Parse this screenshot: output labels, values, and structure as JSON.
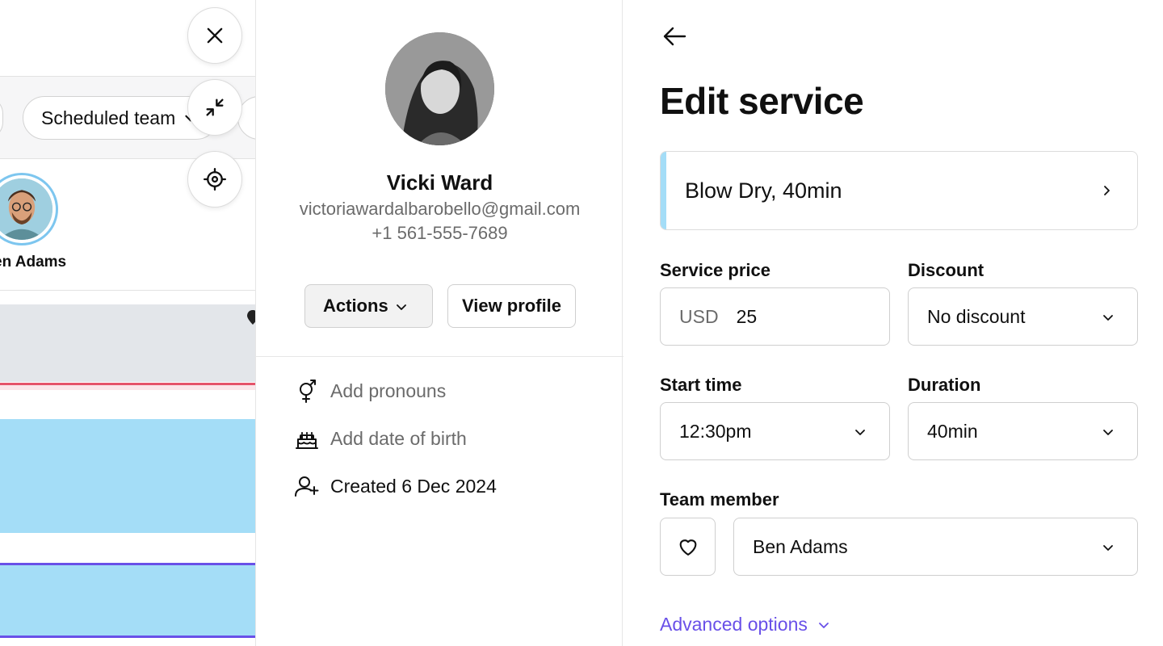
{
  "calendar": {
    "team_filter_label": "Scheduled team",
    "member_name": "en Adams",
    "colors": {
      "pink_line": "#e5546a",
      "purple_line": "#6950e8",
      "appointment_blue": "#a4ddf7",
      "blocked_grey": "#e3e6ea"
    }
  },
  "floating_buttons": {
    "close_icon": "close-icon",
    "minimize_icon": "minimize-icon",
    "locate_icon": "target-icon"
  },
  "client": {
    "name": "Vicki Ward",
    "email": "victoriawardalbarobello@gmail.com",
    "phone": "+1 561-555-7689",
    "actions_label": "Actions",
    "view_profile_label": "View profile",
    "details": [
      {
        "icon": "gender-icon",
        "text": "Add pronouns"
      },
      {
        "icon": "cake-icon",
        "text": "Add date of birth"
      },
      {
        "icon": "user-plus-icon",
        "text": "Created 6 Dec 2024"
      }
    ]
  },
  "edit_service": {
    "title": "Edit service",
    "service_name": "Blow Dry, 40min",
    "service_accent_color": "#a4ddf7",
    "price_label": "Service price",
    "price_currency": "USD",
    "price_value": "25",
    "discount_label": "Discount",
    "discount_value": "No discount",
    "start_time_label": "Start time",
    "start_time_value": "12:30pm",
    "duration_label": "Duration",
    "duration_value": "40min",
    "team_member_label": "Team member",
    "team_member_value": "Ben Adams",
    "advanced_options_label": "Advanced options",
    "link_color": "#6950e8"
  }
}
